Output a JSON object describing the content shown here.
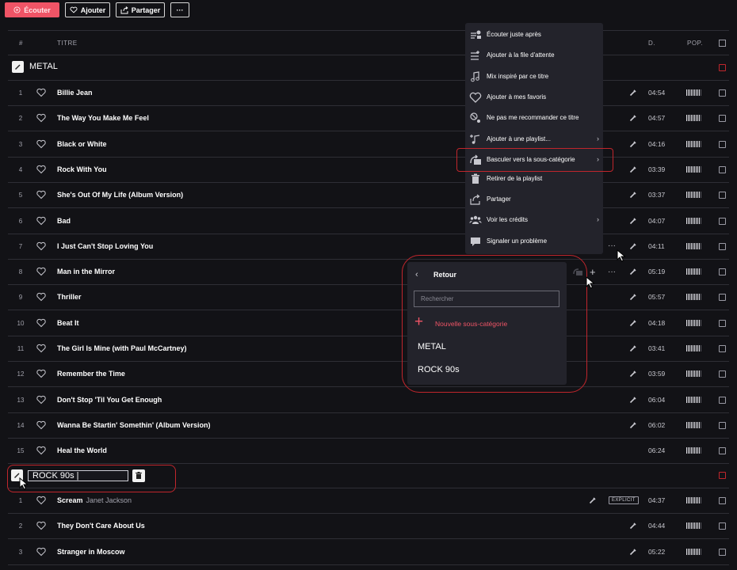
{
  "toolbar": {
    "listen_label": "Écouter",
    "add_label": "Ajouter",
    "share_label": "Partager",
    "more_label": "···"
  },
  "header": {
    "num": "#",
    "title": "TITRE",
    "duration": "D.",
    "popularity": "POP."
  },
  "sections": {
    "metal": "METAL",
    "rock_input_value": "ROCK 90s |"
  },
  "tracks_metal": [
    {
      "num": "1",
      "title": "Billie Jean",
      "duration": "04:54"
    },
    {
      "num": "2",
      "title": "The Way You Make Me Feel",
      "duration": "04:57"
    },
    {
      "num": "3",
      "title": "Black or White",
      "duration": "04:16"
    },
    {
      "num": "4",
      "title": "Rock With You",
      "duration": "03:39"
    },
    {
      "num": "5",
      "title": "She's Out Of My Life (Album Version)",
      "duration": "03:37"
    },
    {
      "num": "6",
      "title": "Bad",
      "duration": "04:07"
    },
    {
      "num": "7",
      "title": "I Just Can't Stop Loving You",
      "duration": "04:11"
    },
    {
      "num": "8",
      "title": "Man in the Mirror",
      "duration": "05:19"
    },
    {
      "num": "9",
      "title": "Thriller",
      "duration": "05:57"
    },
    {
      "num": "10",
      "title": "Beat It",
      "duration": "04:18"
    },
    {
      "num": "11",
      "title": "The Girl Is Mine (with Paul McCartney)",
      "duration": "03:41"
    },
    {
      "num": "12",
      "title": "Remember the Time",
      "duration": "03:59"
    },
    {
      "num": "13",
      "title": "Don't Stop 'Til You Get Enough",
      "duration": "06:04"
    },
    {
      "num": "14",
      "title": "Wanna Be Startin' Somethin' (Album Version)",
      "duration": "06:02"
    },
    {
      "num": "15",
      "title": "Heal the World",
      "duration": "06:24"
    }
  ],
  "tracks_rock": [
    {
      "num": "1",
      "title": "Scream",
      "artist": "Janet Jackson",
      "badge": "EXPLICIT",
      "duration": "04:37"
    },
    {
      "num": "2",
      "title": "They Don't Care About Us",
      "duration": "04:44"
    },
    {
      "num": "3",
      "title": "Stranger in Moscow",
      "duration": "05:22"
    }
  ],
  "context_menu": [
    {
      "label": "Écouter juste après",
      "icon": "play-next-icon"
    },
    {
      "label": "Ajouter à la file d'attente",
      "icon": "queue-icon"
    },
    {
      "label": "Mix inspiré par ce titre",
      "icon": "music-note-icon"
    },
    {
      "label": "Ajouter à mes favoris",
      "icon": "heart-icon"
    },
    {
      "label": "Ne pas me recommander ce titre",
      "icon": "no-recommend-icon"
    },
    {
      "label": "Ajouter à une playlist...",
      "icon": "add-playlist-icon",
      "chevron": true
    },
    {
      "label": "Basculer vers la sous-catégorie",
      "icon": "move-category-icon",
      "chevron": true
    },
    {
      "label": "Retirer de la playlist",
      "icon": "trash-icon"
    },
    {
      "label": "Partager",
      "icon": "share-icon"
    },
    {
      "label": "Voir les crédits",
      "icon": "credits-icon",
      "chevron": true
    },
    {
      "label": "Signaler un problème",
      "icon": "report-icon"
    }
  ],
  "submenu": {
    "back_label": "Retour",
    "search_placeholder": "Rechercher",
    "new_label": "Nouvelle sous-catégorie",
    "options": [
      "METAL",
      "ROCK 90s"
    ]
  },
  "colors": {
    "accent": "#ef5466",
    "highlight_red": "#c0262c",
    "bg": "#121216",
    "menu_bg": "#23232b"
  }
}
